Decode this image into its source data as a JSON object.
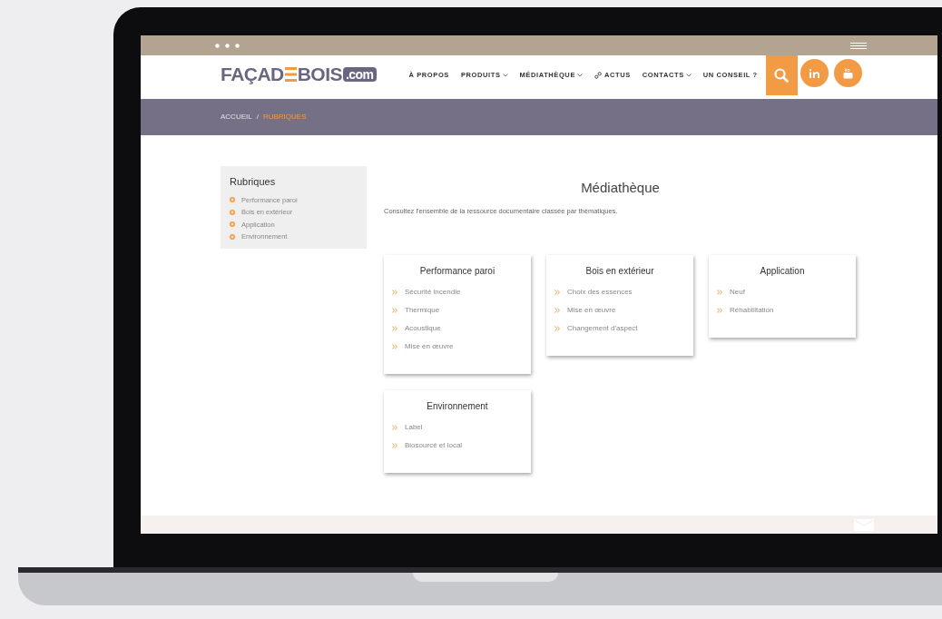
{
  "logo": {
    "left": "FAÇAD",
    "right": "BOIS",
    "suffix": ".com"
  },
  "nav": [
    {
      "label": "À PROPOS",
      "dropdown": false,
      "kind": "text"
    },
    {
      "label": "PRODUITS",
      "dropdown": true,
      "kind": "text"
    },
    {
      "label": "MÉDIATHÈQUE",
      "dropdown": true,
      "kind": "text"
    },
    {
      "label": "ACTUS",
      "dropdown": false,
      "kind": "link-icon"
    },
    {
      "label": "CONTACTS",
      "dropdown": true,
      "kind": "text"
    },
    {
      "label": "UN CONSEIL ?",
      "dropdown": false,
      "kind": "text"
    }
  ],
  "breadcrumb": [
    {
      "label": "ACCUEIL",
      "selected": false
    },
    {
      "label": "/",
      "selected": false
    },
    {
      "label": "RUBRIQUES",
      "selected": true
    }
  ],
  "sidebar": {
    "title": "Rubriques",
    "items": [
      "Performance paroi",
      "Bois en extérieur",
      "Application",
      "Environnement"
    ]
  },
  "main": {
    "title": "Médiathèque",
    "description": "Consultez l'ensemble de la ressource documentaire classée par thématiques."
  },
  "cards": [
    {
      "title": "Performance paroi",
      "items": [
        "Sécurité incendie",
        "Thermique",
        "Acoustique",
        "Mise en œuvre"
      ]
    },
    {
      "title": "Bois en extérieur",
      "items": [
        "Choix des essences",
        "Mise en œuvre",
        "Changement d'aspect"
      ]
    },
    {
      "title": "Application",
      "items": [
        "Neuf",
        "Réhabilitation"
      ]
    },
    {
      "title": "Environnement",
      "items": [
        "Label",
        "Biosourcé et local"
      ]
    }
  ]
}
